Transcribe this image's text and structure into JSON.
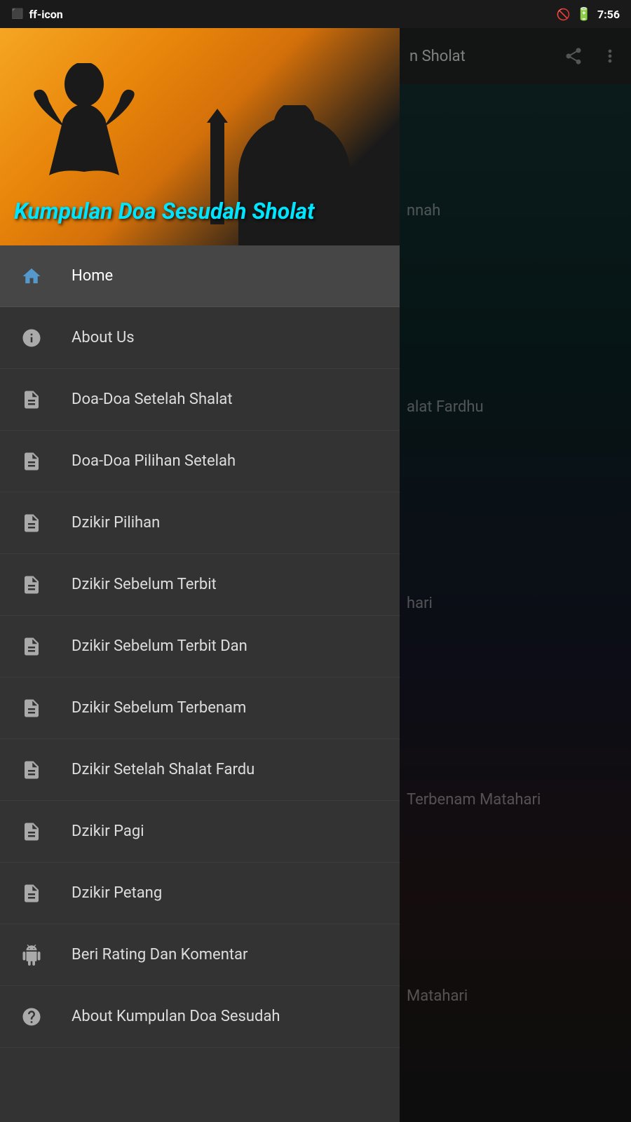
{
  "statusBar": {
    "time": "7:56",
    "leftIcons": [
      "screen-icon",
      "ff-icon"
    ],
    "rightIcons": [
      "signal-icon",
      "battery-icon"
    ]
  },
  "toolbar": {
    "title": "n Sholat",
    "shareIcon": "share",
    "moreIcon": "more-vert"
  },
  "drawerHeader": {
    "appTitle": "Kumpulan Doa Sesudah Sholat"
  },
  "menuItems": [
    {
      "id": "home",
      "label": "Home",
      "icon": "home",
      "active": true
    },
    {
      "id": "about-us",
      "label": "About Us",
      "icon": "info",
      "active": false
    },
    {
      "id": "doa-setelah-shalat",
      "label": "Doa-Doa Setelah Shalat",
      "icon": "document",
      "active": false
    },
    {
      "id": "doa-pilihan",
      "label": "Doa-Doa Pilihan Setelah",
      "icon": "document",
      "active": false
    },
    {
      "id": "dzikir-pilihan",
      "label": "Dzikir Pilihan",
      "icon": "document",
      "active": false
    },
    {
      "id": "dzikir-sebelum-terbit",
      "label": "Dzikir Sebelum Terbit",
      "icon": "document",
      "active": false
    },
    {
      "id": "dzikir-sebelum-terbit-dan",
      "label": "Dzikir Sebelum Terbit Dan",
      "icon": "document",
      "active": false
    },
    {
      "id": "dzikir-sebelum-terbenam",
      "label": "Dzikir Sebelum Terbenam",
      "icon": "document",
      "active": false
    },
    {
      "id": "dzikir-setelah-shalat-fardu",
      "label": "Dzikir Setelah Shalat Fardu",
      "icon": "document",
      "active": false
    },
    {
      "id": "dzikir-pagi",
      "label": "Dzikir Pagi",
      "icon": "document",
      "active": false
    },
    {
      "id": "dzikir-petang",
      "label": "Dzikir Petang",
      "icon": "document",
      "active": false
    },
    {
      "id": "beri-rating",
      "label": "Beri Rating Dan Komentar",
      "icon": "android",
      "active": false
    },
    {
      "id": "about-kumpulan",
      "label": "About Kumpulan Doa Sesudah",
      "icon": "help",
      "active": false
    }
  ],
  "rightContent": [
    {
      "text": "nnah"
    },
    {
      "text": "alat Fardhu"
    },
    {
      "text": "hari"
    },
    {
      "text": "Terbenam Matahari"
    },
    {
      "text": "Matahari"
    }
  ]
}
